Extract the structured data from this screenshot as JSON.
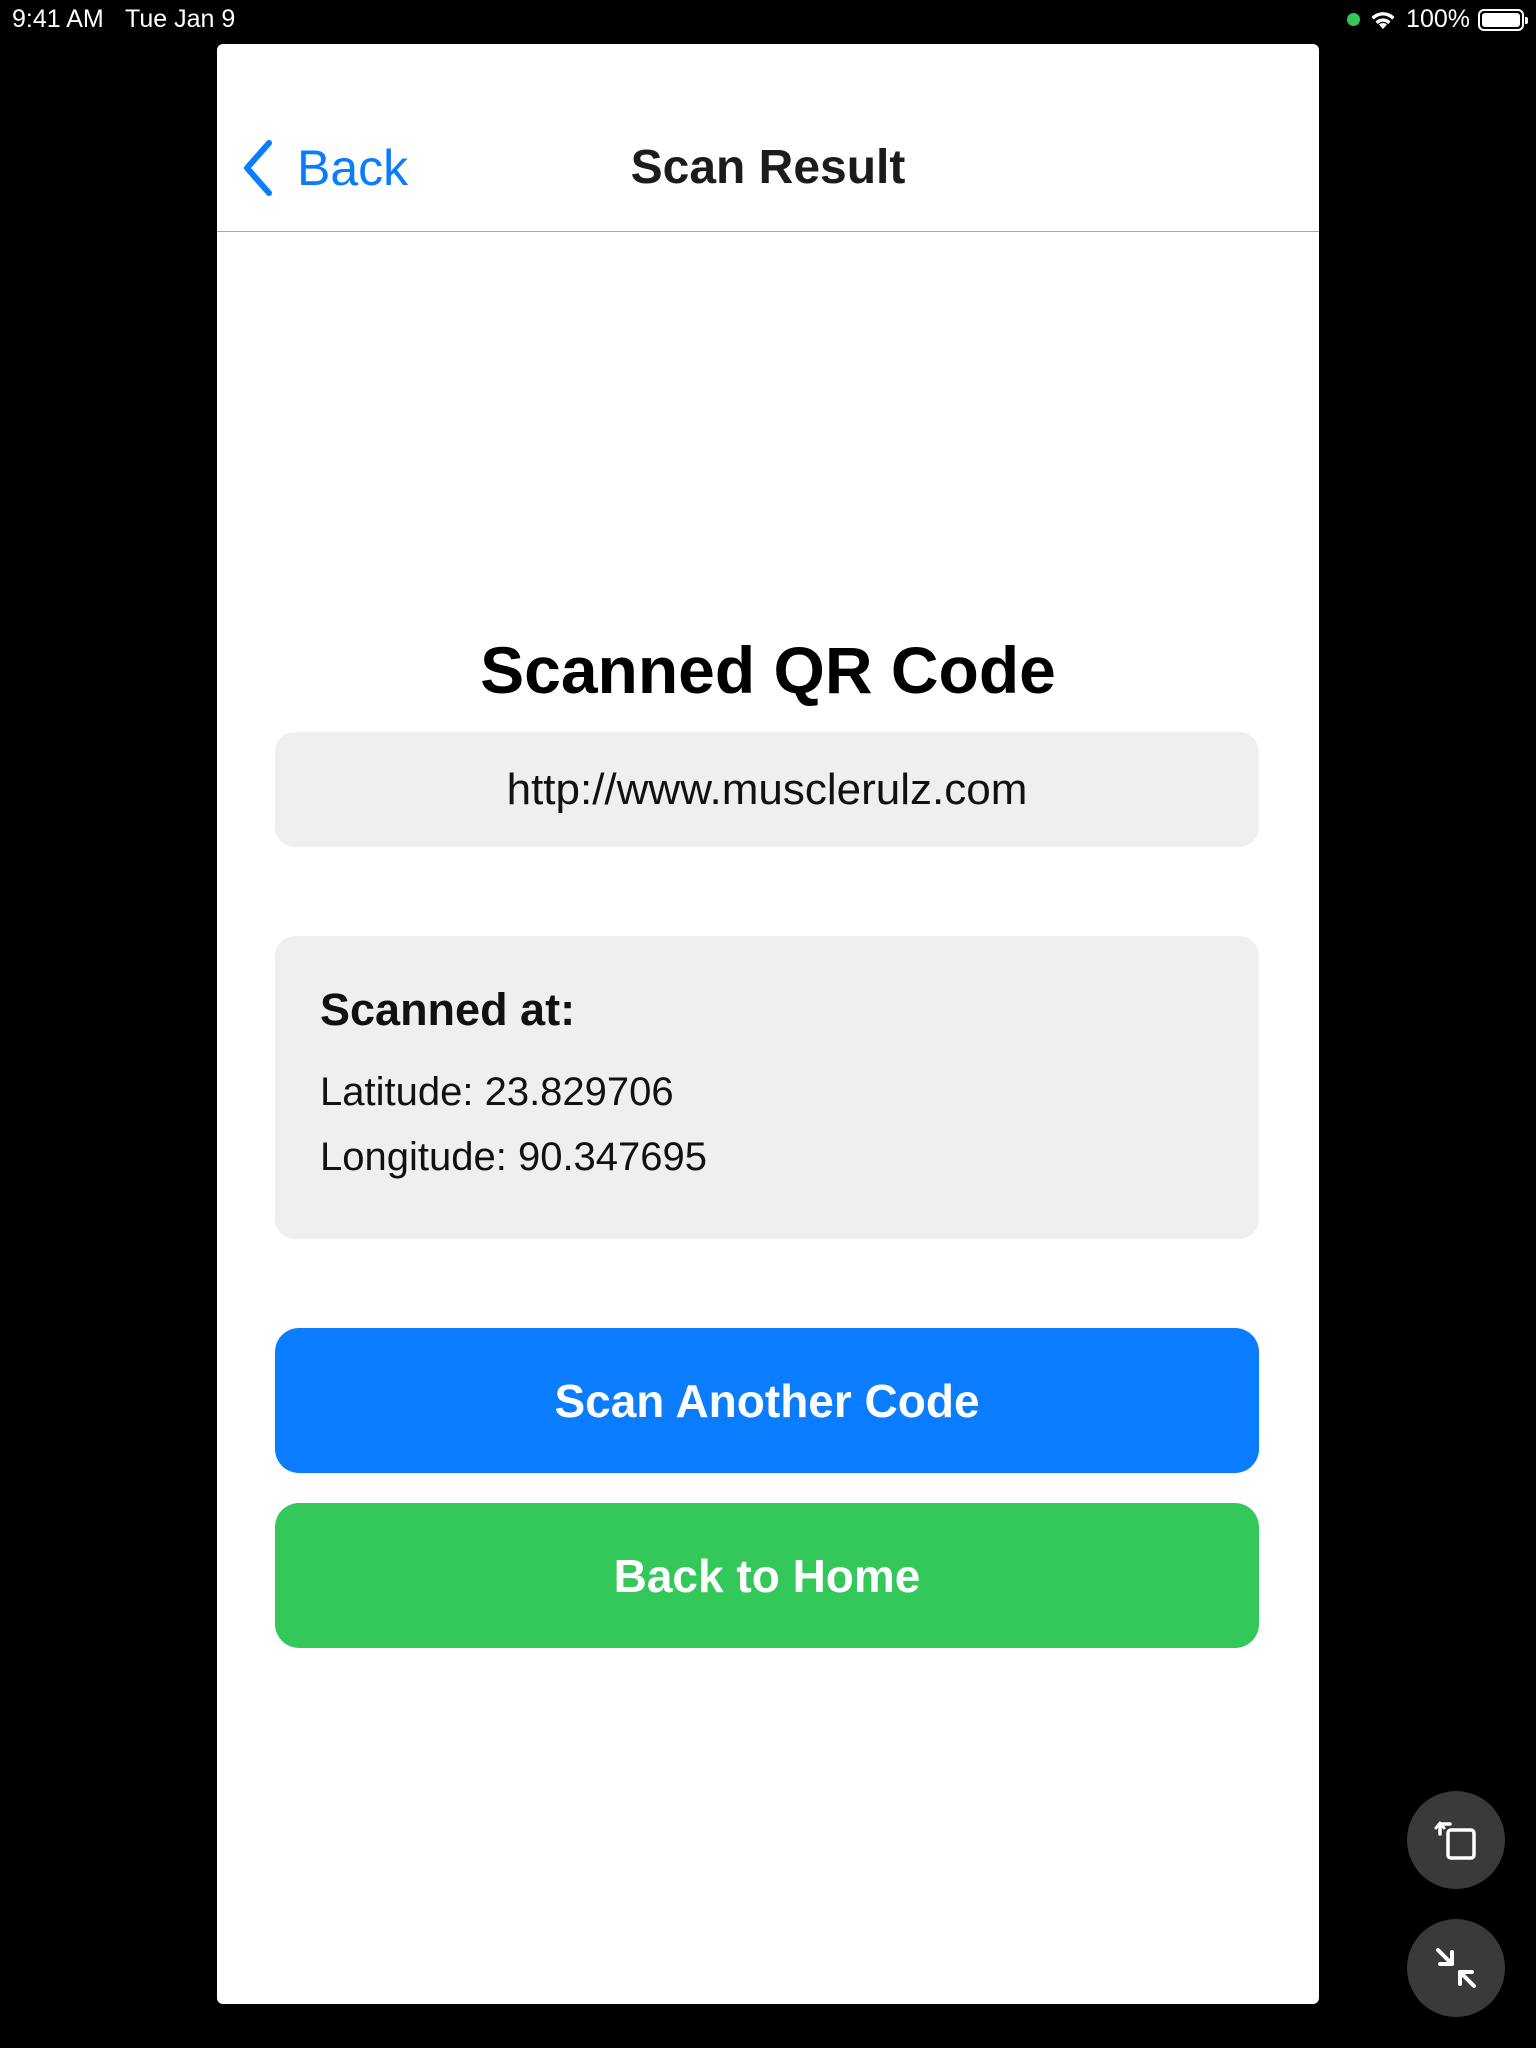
{
  "status_bar": {
    "time": "9:41 AM",
    "date": "Tue Jan 9",
    "battery": "100%",
    "icons": [
      "green-dot-indicator",
      "wifi-icon",
      "battery-icon"
    ]
  },
  "nav": {
    "back_label": "Back",
    "title": "Scan Result",
    "back_icon": "chevron-left-icon"
  },
  "result": {
    "heading": "Scanned QR Code",
    "url": "http://www.musclerulz.com"
  },
  "location": {
    "heading": "Scanned at:",
    "latitude": "Latitude: 23.829706",
    "longitude": "Longitude: 90.347695"
  },
  "actions": {
    "scan_another_label": "Scan Another Code",
    "back_home_label": "Back to Home"
  },
  "floating_controls": {
    "rotate_icon": "rotate-screen-icon",
    "shrink_icon": "shrink-window-icon"
  },
  "colors": {
    "accent_blue": "#0a7cff",
    "accent_green": "#34c85a",
    "card_background": "#efefef",
    "background": "#000000"
  }
}
